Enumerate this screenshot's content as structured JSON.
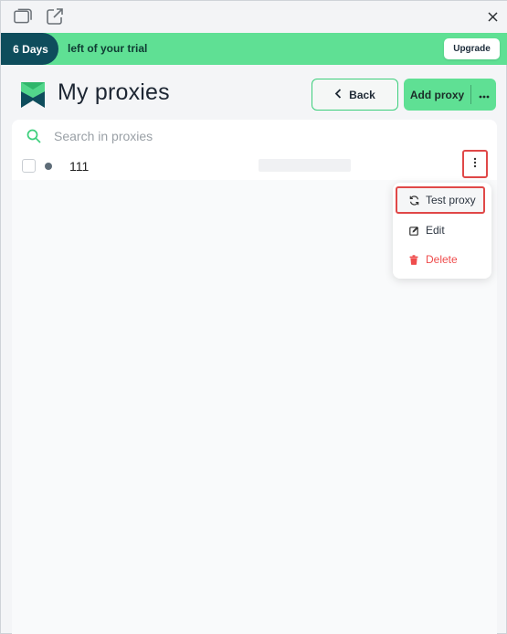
{
  "window": {
    "icons": [
      "window-icon",
      "external-link-icon",
      "close-icon"
    ]
  },
  "trial": {
    "days": "6 Days",
    "message": "left of your trial",
    "upgrade_label": "Upgrade"
  },
  "header": {
    "title": "My proxies",
    "back_label": "Back",
    "add_proxy_label": "Add proxy"
  },
  "search": {
    "placeholder": "Search in proxies",
    "value": ""
  },
  "proxies": [
    {
      "name": "111",
      "status_color": "#5e6c78"
    }
  ],
  "context_menu": {
    "items": [
      {
        "label": "Test proxy",
        "icon": "refresh-icon"
      },
      {
        "label": "Edit",
        "icon": "edit-icon"
      },
      {
        "label": "Delete",
        "icon": "trash-icon"
      }
    ]
  },
  "colors": {
    "accent": "#5fe094",
    "dark": "#0e4d5c",
    "danger": "#ef4d4d",
    "highlight_border": "#e04848"
  }
}
